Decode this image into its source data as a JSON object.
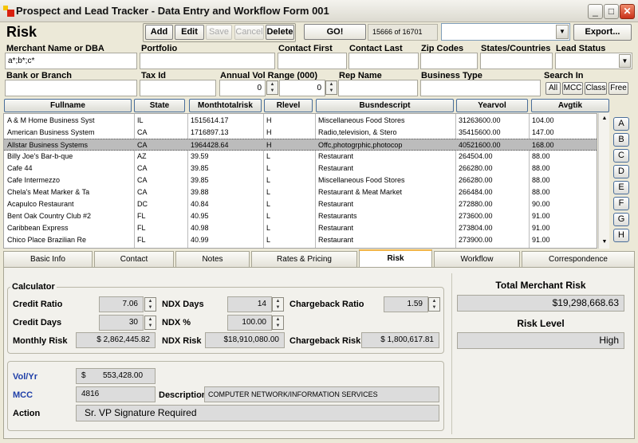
{
  "window": {
    "title": "Prospect and Lead Tracker - Data Entry and Workflow Form 001"
  },
  "header": {
    "title": "Risk",
    "record_count": "15666 of 16701"
  },
  "toolbar": {
    "add": "Add",
    "edit": "Edit",
    "save": "Save",
    "cancel": "Cancel",
    "delete": "Delete",
    "go": "GO!",
    "export": "Export..."
  },
  "search": {
    "merchant_label": "Merchant Name or DBA",
    "merchant_value": "a*;b*;c*",
    "portfolio_label": "Portfolio",
    "contact_first_label": "Contact First",
    "contact_last_label": "Contact Last",
    "zip_label": "Zip Codes",
    "states_label": "States/Countries",
    "lead_status_label": "Lead Status",
    "bank_label": "Bank or Branch",
    "taxid_label": "Tax Id",
    "annual_vol_label": "Annual Vol Range (000)",
    "vol_from": "0",
    "vol_to": "0",
    "rep_label": "Rep Name",
    "business_type_label": "Business Type",
    "search_in_label": "Search In",
    "search_in": [
      "All",
      "MCC",
      "Class",
      "Free"
    ]
  },
  "grid": {
    "columns": [
      "Fullname",
      "State",
      "Monthtotalrisk",
      "Rlevel",
      "Busndescript",
      "Yearvol",
      "Avgtik"
    ],
    "rows": [
      [
        "A & M Home Business Syst",
        "IL",
        "1515614.17",
        "H",
        "Miscellaneous Food Stores",
        "31263600.00",
        "104.00"
      ],
      [
        "American Business System",
        "CA",
        "1716897.13",
        "H",
        "Radio,television, & Stero",
        "35415600.00",
        "147.00"
      ],
      [
        "Allstar Business Systems",
        "CA",
        "1964428.64",
        "H",
        "Offc,photogrphic,photocop",
        "40521600.00",
        "168.00"
      ],
      [
        "Billy Joe's Bar-b-que",
        "AZ",
        "39.59",
        "L",
        "Restaurant",
        "264504.00",
        "88.00"
      ],
      [
        "Cafe 44",
        "CA",
        "39.85",
        "L",
        "Restaurant",
        "266280.00",
        "88.00"
      ],
      [
        "Cafe Intermezzo",
        "CA",
        "39.85",
        "L",
        "Miscellaneous Food Stores",
        "266280.00",
        "88.00"
      ],
      [
        "Chela's Meat Marker & Ta",
        "CA",
        "39.88",
        "L",
        "Restaurant & Meat Market",
        "266484.00",
        "88.00"
      ],
      [
        "Acapulco Restaurant",
        "DC",
        "40.84",
        "L",
        "Restaurant",
        "272880.00",
        "90.00"
      ],
      [
        "Bent Oak Country Club #2",
        "FL",
        "40.95",
        "L",
        "Restaurants",
        "273600.00",
        "91.00"
      ],
      [
        "Caribbean Express",
        "FL",
        "40.98",
        "L",
        "Restaurant",
        "273804.00",
        "91.00"
      ],
      [
        "Chico Place Brazilian Re",
        "FL",
        "40.99",
        "L",
        "Restaurant",
        "273900.00",
        "91.00"
      ]
    ],
    "alpha": [
      "A",
      "B",
      "C",
      "D",
      "E",
      "F",
      "G",
      "H"
    ]
  },
  "tabs": [
    "Basic Info",
    "Contact",
    "Notes",
    "Rates & Pricing",
    "Risk",
    "Workflow",
    "Correspondence"
  ],
  "risk": {
    "calculator_label": "Calculator",
    "credit_ratio_label": "Credit Ratio",
    "credit_ratio": "7.06",
    "credit_days_label": "Credit Days",
    "credit_days": "30",
    "monthly_risk_label": "Monthly Risk",
    "monthly_risk": "$ 2,862,445.82",
    "ndx_days_label": "NDX Days",
    "ndx_days": "14",
    "ndx_pct_label": "NDX %",
    "ndx_pct": "100.00",
    "ndx_risk_label": "NDX Risk",
    "ndx_risk": "$18,910,080.00",
    "chargeback_ratio_label": "Chargeback Ratio",
    "chargeback_ratio": "1.59",
    "chargeback_risk_label": "Chargeback Risk",
    "chargeback_risk": "$ 1,800,617.81",
    "total_label": "Total Merchant Risk",
    "total": "$19,298,668.63",
    "level_label": "Risk Level",
    "level": "High",
    "vol_label": "Vol/Yr",
    "vol_prefix": "$",
    "vol": "553,428.00",
    "mcc_label": "MCC",
    "mcc": "4816",
    "desc_label": "Description",
    "desc": "COMPUTER NETWORK/INFORMATION SERVICES",
    "action_label": "Action",
    "action": "Sr. VP Signature Required"
  }
}
